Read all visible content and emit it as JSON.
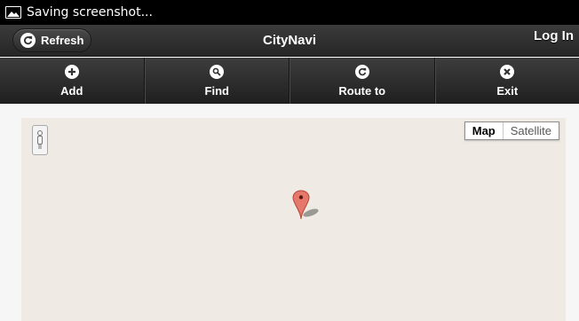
{
  "status_bar": {
    "icon": "image-icon",
    "text": "Saving screenshot..."
  },
  "header": {
    "refresh_label": "Refresh",
    "title": "CityNavi",
    "login_label": "Log In"
  },
  "nav": [
    {
      "label": "Add",
      "icon": "plus-icon"
    },
    {
      "label": "Find",
      "icon": "search-icon"
    },
    {
      "label": "Route to",
      "icon": "route-icon"
    },
    {
      "label": "Exit",
      "icon": "close-icon"
    }
  ],
  "map": {
    "type_options": [
      "Map",
      "Satellite"
    ],
    "selected_type": "Map",
    "marker_color": "#e5776b"
  },
  "colors": {
    "toolbar": "#2e2e2e",
    "map_background": "#efebe4"
  }
}
